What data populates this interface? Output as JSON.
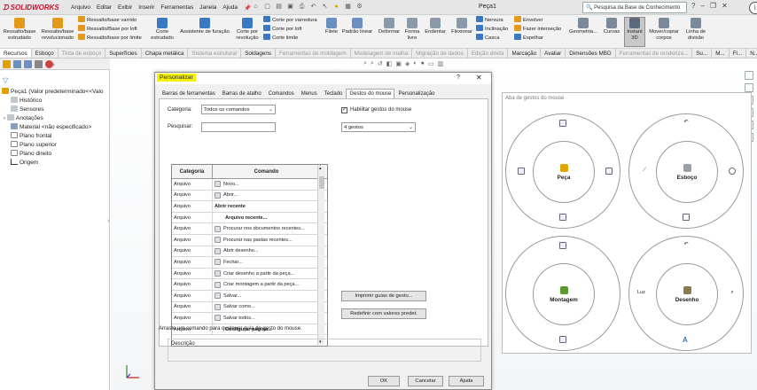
{
  "app": {
    "logo_text": "SOLIDWORKS",
    "document_title": "Peça1",
    "search_placeholder": "Pesquisa da Base de Conhecimento"
  },
  "menu": [
    "Arquivo",
    "Editar",
    "Exibir",
    "Inserir",
    "Ferramentas",
    "Janela",
    "Ajuda"
  ],
  "ribbon": {
    "big_buttons": [
      {
        "label": "Ressalto/base\nextrudado",
        "icon": "extrude-boss-icon"
      },
      {
        "label": "Ressalto/base\nrevolucionado",
        "icon": "revolve-boss-icon"
      },
      {
        "label": "Corte\nextrudado",
        "icon": "extrude-cut-icon"
      },
      {
        "label": "Assistente de furação",
        "icon": "hole-wizard-icon"
      },
      {
        "label": "Corte por\nrevolução",
        "icon": "revolve-cut-icon"
      },
      {
        "label": "Filete",
        "icon": "fillet-icon"
      },
      {
        "label": "Padrão linear",
        "icon": "linear-pattern-icon"
      },
      {
        "label": "Deformar",
        "icon": "deform-icon"
      },
      {
        "label": "Forma\nlivre",
        "icon": "freeform-icon"
      },
      {
        "label": "Endentar",
        "icon": "indent-icon"
      },
      {
        "label": "Flexionar",
        "icon": "flex-icon"
      },
      {
        "label": "Geometria...",
        "icon": "reference-geometry-icon"
      },
      {
        "label": "Curvas",
        "icon": "curves-icon"
      },
      {
        "label": "Instant\n3D",
        "icon": "instant3d-icon"
      },
      {
        "label": "Mover/copiar\ncorpos",
        "icon": "move-copy-icon"
      },
      {
        "label": "Linha de\ndivisão",
        "icon": "split-line-icon"
      }
    ],
    "small_group_1": [
      "Ressalto/base varrido",
      "Ressalto/Base por loft",
      "Ressalto/base por limite"
    ],
    "small_group_2": [
      "Corte por varredura",
      "Corte por loft",
      "Corte limite"
    ],
    "small_group_3": [
      "Nervura",
      "Inclinação",
      "Casca"
    ],
    "small_group_4": [
      "Envolver",
      "Fazer interseção",
      "Espelhar"
    ]
  },
  "tabs": [
    {
      "label": "Recursos",
      "state": "act"
    },
    {
      "label": "Esboço",
      "state": ""
    },
    {
      "label": "Tinta de esboço",
      "state": "dim"
    },
    {
      "label": "Superfícies",
      "state": ""
    },
    {
      "label": "Chapa metálica",
      "state": ""
    },
    {
      "label": "Sistema estrutural",
      "state": "dim"
    },
    {
      "label": "Soldagens",
      "state": ""
    },
    {
      "label": "Ferramentas de moldagem",
      "state": "dim"
    },
    {
      "label": "Modelagem de malha",
      "state": "dim"
    },
    {
      "label": "Migração de dados",
      "state": "dim"
    },
    {
      "label": "Edição direta",
      "state": "dim"
    },
    {
      "label": "Marcação",
      "state": ""
    },
    {
      "label": "Avaliar",
      "state": ""
    },
    {
      "label": "Dimensões MBD",
      "state": ""
    },
    {
      "label": "Ferramentas de renderiza...",
      "state": "dim"
    },
    {
      "label": "Su...",
      "state": ""
    },
    {
      "label": "M...",
      "state": ""
    },
    {
      "label": "Fl...",
      "state": ""
    },
    {
      "label": "N...",
      "state": ""
    }
  ],
  "tree": [
    {
      "label": "Peça1  (Valor predeterminado<<Valo",
      "icon": "part-icon"
    },
    {
      "label": "Histórico",
      "icon": "history-icon"
    },
    {
      "label": "Sensores",
      "icon": "sensor-icon"
    },
    {
      "label": "Anotações",
      "icon": "annotation-icon"
    },
    {
      "label": "Material <não especificado>",
      "icon": "material-icon"
    },
    {
      "label": "Plano frontal",
      "icon": "plane-icon"
    },
    {
      "label": "Plano superior",
      "icon": "plane-icon"
    },
    {
      "label": "Plano direito",
      "icon": "plane-icon"
    },
    {
      "label": "Origem",
      "icon": "origin-icon"
    }
  ],
  "dialog": {
    "title": "Personalizar",
    "help": "?",
    "tabs": [
      {
        "label": "Barras de ferramentas",
        "state": ""
      },
      {
        "label": "Barras de atalho",
        "state": ""
      },
      {
        "label": "Comandos",
        "state": ""
      },
      {
        "label": "Menus",
        "state": ""
      },
      {
        "label": "Teclado",
        "state": ""
      },
      {
        "label": "Gestos do mouse",
        "state": "act"
      },
      {
        "label": "Personalização",
        "state": ""
      }
    ],
    "category_label": "Categoria:",
    "category_value": "Todos os comandos",
    "search_label": "Pesquisar:",
    "search_value": "",
    "enable_label": "Habilitar gestos do mouse",
    "enable_checked": "✓",
    "gestures_value": "4 gestos",
    "table_headers": [
      "Categoria",
      "Comando"
    ],
    "rows": [
      {
        "cat": "Arquivo",
        "cmd": "Novo...",
        "icon": true
      },
      {
        "cat": "Arquivo",
        "cmd": "Abrir...",
        "icon": true
      },
      {
        "cat": "Arquivo",
        "cmd": "Abrir recente",
        "icon": false
      },
      {
        "cat": "Arquivo",
        "cmd": "Arquivo recente...",
        "icon": false
      },
      {
        "cat": "Arquivo",
        "cmd": "Procurar nos documentos recentes...",
        "icon": true
      },
      {
        "cat": "Arquivo",
        "cmd": "Procurar nas pastas recentes...",
        "icon": true
      },
      {
        "cat": "Arquivo",
        "cmd": "Abrir desenho...",
        "icon": true
      },
      {
        "cat": "Arquivo",
        "cmd": "Fechar...",
        "icon": true
      },
      {
        "cat": "Arquivo",
        "cmd": "Criar desenho a partir da peça...",
        "icon": true
      },
      {
        "cat": "Arquivo",
        "cmd": "Criar montagem a partir da peça...",
        "icon": true
      },
      {
        "cat": "Arquivo",
        "cmd": "Salvar...",
        "icon": true
      },
      {
        "cat": "Arquivo",
        "cmd": "Salvar como...",
        "icon": true
      },
      {
        "cat": "Arquivo",
        "cmd": "Salvar todos...",
        "icon": true
      },
      {
        "cat": "Arquivo",
        "cmd": "Configurar página...",
        "icon": false
      }
    ],
    "print_button": "Imprimir guias de gesto...",
    "reset_button": "Redefinir com valores predet.",
    "hint": "Arraste um comando para qualquer guia de gesto do mouse.",
    "description_label": "Descrição",
    "ok": "OK",
    "cancel": "Cancelar",
    "help_button": "Ajuda"
  },
  "gestures": {
    "header": "Aba de gestos do mouse",
    "wheels": [
      {
        "label": "Peça",
        "icon_color": "#e2a400"
      },
      {
        "label": "Esboço",
        "icon_color": "#9aa0a8"
      },
      {
        "label": "Montagem",
        "icon_color": "#5a9a2e"
      },
      {
        "label": "Desenho",
        "icon_color": "#8a7a50"
      }
    ],
    "luz_label": "Luz",
    "text_glyph": "A"
  },
  "colors": {
    "accent_red": "#c8102e",
    "highlight_yellow": "#f4f000",
    "ribbon_icon_blue": "#3b78c2",
    "ribbon_icon_orange": "#e39a1b"
  }
}
